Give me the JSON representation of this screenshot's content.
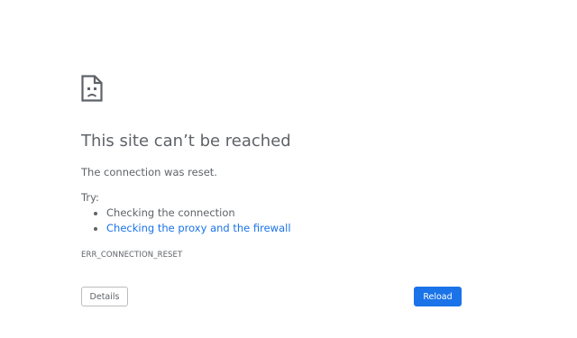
{
  "error": {
    "icon": "sad-page-icon",
    "title": "This site can’t be reached",
    "subtitle": "The connection was reset.",
    "try_label": "Try:",
    "suggestions": [
      {
        "text": "Checking the connection",
        "is_link": false
      },
      {
        "text": "Checking the proxy and the firewall",
        "is_link": true
      }
    ],
    "code": "ERR_CONNECTION_RESET"
  },
  "buttons": {
    "details_label": "Details",
    "reload_label": "Reload"
  },
  "colors": {
    "text": "#5f6368",
    "link": "#1a73e8",
    "primary_button": "#1a73e8",
    "primary_button_text": "#ffffff",
    "secondary_border": "#babcbf"
  }
}
